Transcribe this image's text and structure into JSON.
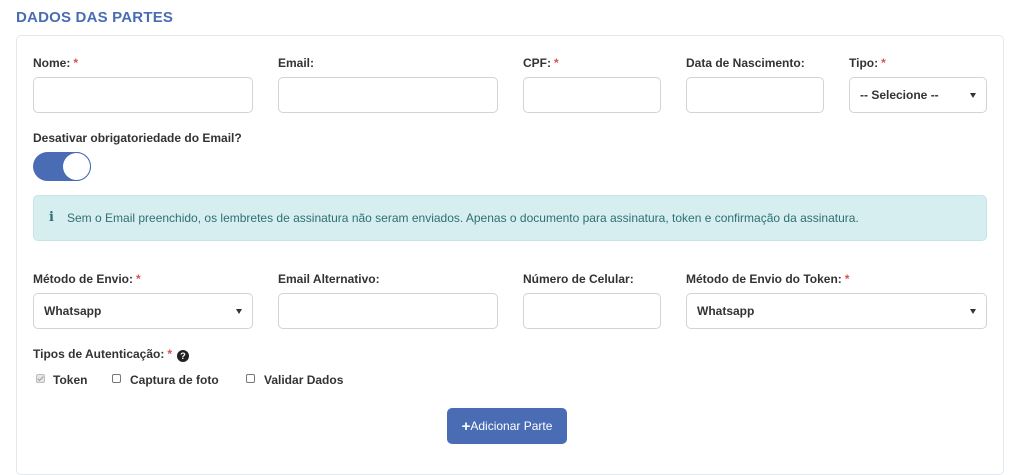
{
  "section": {
    "title": "DADOS DAS PARTES"
  },
  "fields": {
    "nome": {
      "label": "Nome:",
      "required": "*",
      "value": ""
    },
    "email": {
      "label": "Email:",
      "value": ""
    },
    "cpf": {
      "label": "CPF:",
      "required": "*",
      "value": ""
    },
    "data_nascimento": {
      "label": "Data de Nascimento:",
      "value": ""
    },
    "tipo": {
      "label": "Tipo:",
      "required": "*",
      "selected": "-- Selecione --"
    },
    "desativar_email": {
      "label": "Desativar obrigatoriedade do Email?",
      "enabled": true
    },
    "metodo_envio": {
      "label": "Método de Envio:",
      "required": "*",
      "selected": "Whatsapp"
    },
    "email_alternativo": {
      "label": "Email Alternativo:",
      "value": ""
    },
    "numero_celular": {
      "label": "Número de Celular:",
      "value": ""
    },
    "metodo_envio_token": {
      "label": "Método de Envio do Token:",
      "required": "*",
      "selected": "Whatsapp"
    }
  },
  "alert": {
    "icon": "info-icon",
    "icon_glyph": "i",
    "text": "Sem o Email preenchido, os lembretes de assinatura não seram enviados. Apenas o documento para assinatura, token e confirmação da assinatura."
  },
  "autenticacao": {
    "label": "Tipos de Autenticação:",
    "required": "*",
    "help_glyph": "?",
    "options": [
      {
        "label": "Token",
        "checked": true,
        "disabled": true
      },
      {
        "label": "Captura de foto",
        "checked": false
      },
      {
        "label": "Validar Dados",
        "checked": false
      }
    ]
  },
  "actions": {
    "add_label": "Adicionar Parte",
    "add_icon_glyph": "+"
  },
  "colors": {
    "accent": "#4a6cb5",
    "required": "#d9534f",
    "alert_bg": "#d6eef0",
    "alert_text": "#2f6f73"
  }
}
